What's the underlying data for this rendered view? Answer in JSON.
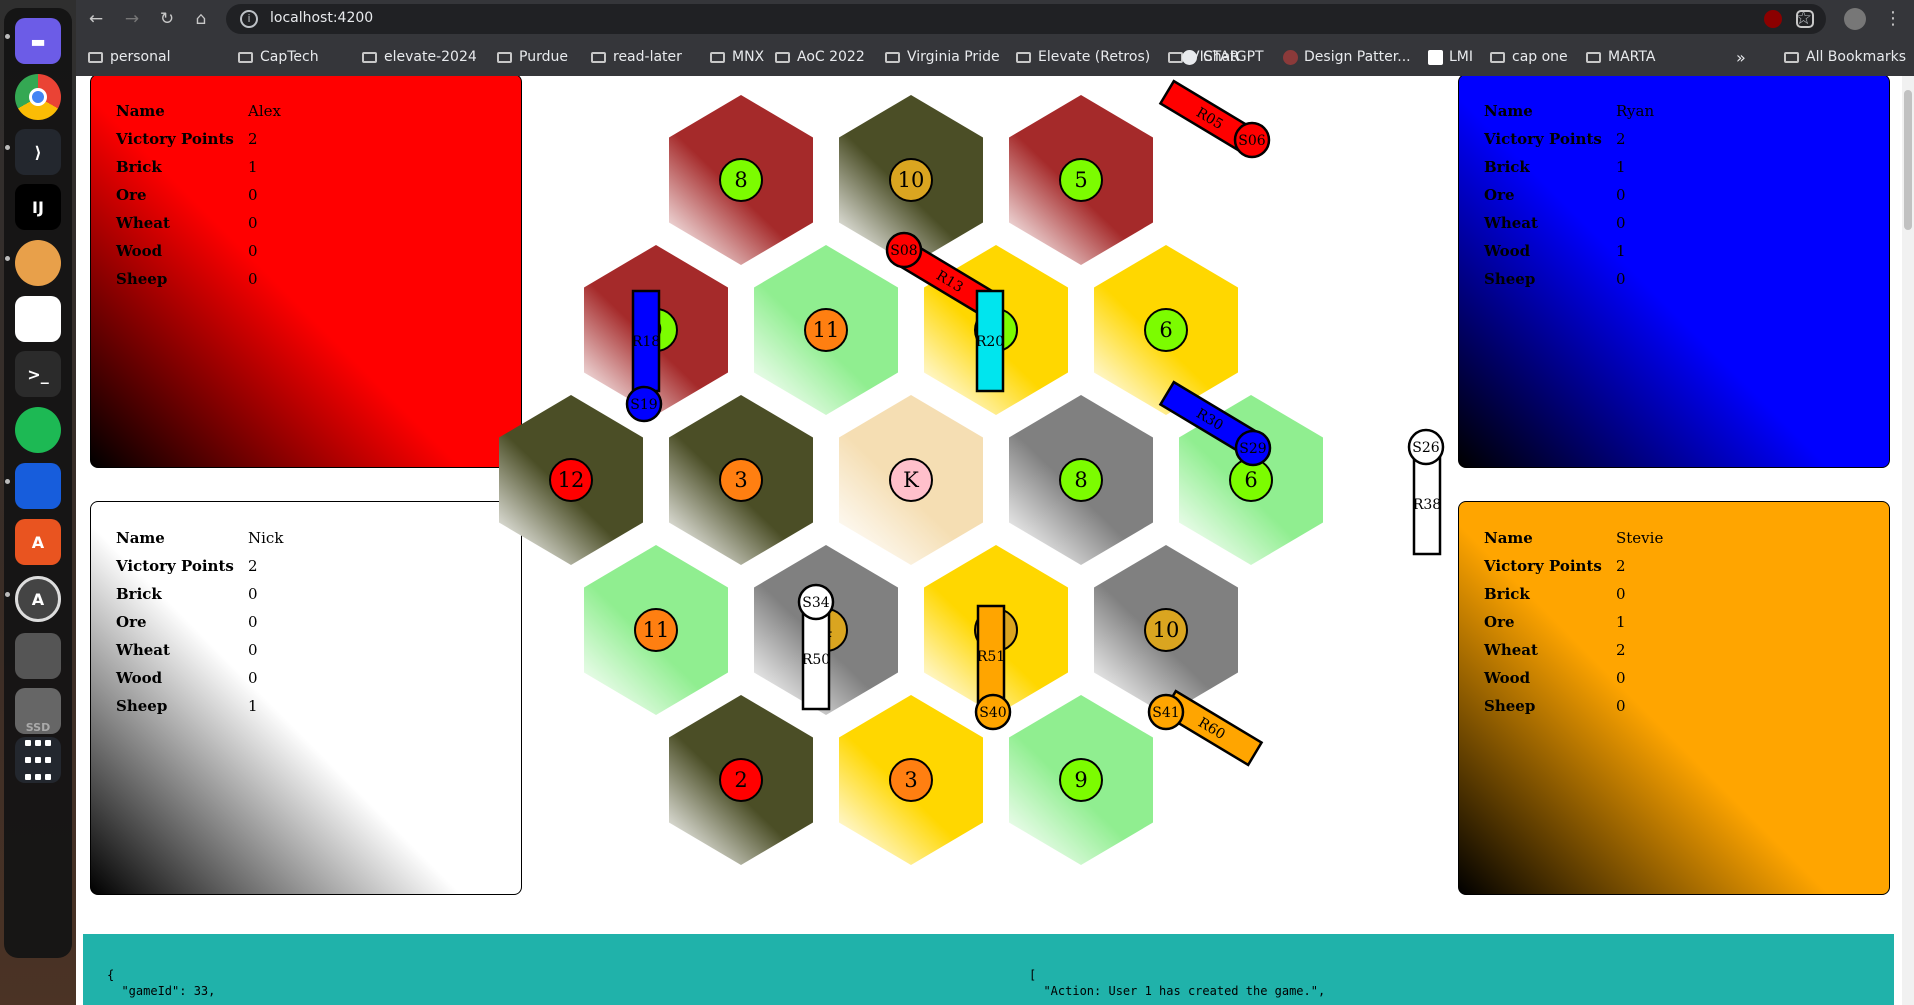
{
  "dock": {
    "items": [
      {
        "name": "files-icon",
        "color": "#6c5ce7",
        "glyph": "▬"
      },
      {
        "name": "chrome-icon",
        "color": "#ffffff",
        "glyph": ""
      },
      {
        "name": "vscode-icon",
        "color": "#23272e",
        "glyph": "⟩"
      },
      {
        "name": "intellij-icon",
        "color": "#000000",
        "glyph": "IJ"
      },
      {
        "name": "dog-icon",
        "color": "#23272e",
        "glyph": ""
      },
      {
        "name": "gimp-icon",
        "color": "#ffffff",
        "glyph": ""
      },
      {
        "name": "terminal-icon",
        "color": "#2b2b2b",
        "glyph": ">_"
      },
      {
        "name": "spotify-icon",
        "color": "#1db954",
        "glyph": ""
      },
      {
        "name": "bitwarden-icon",
        "color": "#175ddc",
        "glyph": ""
      },
      {
        "name": "app-center-icon",
        "color": "#e95420",
        "glyph": "A"
      },
      {
        "name": "software-updater-icon",
        "color": "#444444",
        "glyph": "A"
      },
      {
        "name": "usb-icon",
        "color": "#555555",
        "glyph": ""
      },
      {
        "name": "ssd-icon",
        "color": "#666666",
        "glyph": "SSD"
      },
      {
        "name": "app-grid-icon",
        "color": "#23272e",
        "glyph": ""
      }
    ]
  },
  "browser": {
    "url": "localhost:4200",
    "bookmarks": [
      {
        "label": "personal",
        "type": "folder"
      },
      {
        "label": "CapTech",
        "type": "folder"
      },
      {
        "label": "elevate-2024",
        "type": "folder"
      },
      {
        "label": "Purdue",
        "type": "folder"
      },
      {
        "label": "read-later",
        "type": "folder"
      },
      {
        "label": "MNX",
        "type": "folder"
      },
      {
        "label": "AoC 2022",
        "type": "folder"
      },
      {
        "label": "Virginia Pride",
        "type": "folder"
      },
      {
        "label": "Elevate (Retros)",
        "type": "folder"
      },
      {
        "label": "VISTAR",
        "type": "folder"
      },
      {
        "label": "ChatGPT",
        "type": "site"
      },
      {
        "label": "Design Patter...",
        "type": "site"
      },
      {
        "label": "LMI",
        "type": "site"
      },
      {
        "label": "cap one",
        "type": "folder"
      },
      {
        "label": "MARTA",
        "type": "folder"
      }
    ],
    "overflow": "»",
    "all_bookmarks": "All Bookmarks"
  },
  "stat_labels": [
    "Name",
    "Victory Points",
    "Brick",
    "Ore",
    "Wheat",
    "Wood",
    "Sheep"
  ],
  "players": [
    {
      "id": "alex",
      "name": "Alex",
      "victory_points": "2",
      "brick": "1",
      "ore": "0",
      "wheat": "0",
      "wood": "0",
      "sheep": "0",
      "color": "#ff0000"
    },
    {
      "id": "ryan",
      "name": "Ryan",
      "victory_points": "2",
      "brick": "1",
      "ore": "0",
      "wheat": "0",
      "wood": "1",
      "sheep": "0",
      "color": "#0000ff"
    },
    {
      "id": "nick",
      "name": "Nick",
      "victory_points": "2",
      "brick": "0",
      "ore": "0",
      "wheat": "0",
      "wood": "0",
      "sheep": "1",
      "color": "#ffffff"
    },
    {
      "id": "stevie",
      "name": "Stevie",
      "victory_points": "2",
      "brick": "0",
      "ore": "1",
      "wheat": "2",
      "wood": "0",
      "sheep": "0",
      "color": "#ffa500"
    }
  ],
  "resource_colors": {
    "brick": "#a52a2a",
    "wood": "#4b4e26",
    "wheat": "#ffd700",
    "sheep": "#90ee90",
    "ore": "#808080",
    "desert": "#f5deb3"
  },
  "board": {
    "rows": [
      [
        {
          "r": "brick",
          "n": "8"
        },
        {
          "r": "wood",
          "n": "10"
        },
        {
          "r": "brick",
          "n": "5"
        }
      ],
      [
        {
          "r": "brick",
          "n": "9"
        },
        {
          "r": "sheep",
          "n": "11"
        },
        {
          "r": "wheat",
          "n": "5"
        },
        {
          "r": "wheat",
          "n": "6"
        }
      ],
      [
        {
          "r": "wood",
          "n": "12"
        },
        {
          "r": "wood",
          "n": "3"
        },
        {
          "r": "desert",
          "n": "K"
        },
        {
          "r": "ore",
          "n": "8"
        },
        {
          "r": "sheep",
          "n": "6"
        }
      ],
      [
        {
          "r": "sheep",
          "n": "11"
        },
        {
          "r": "ore",
          "n": "4"
        },
        {
          "r": "wheat",
          "n": "4"
        },
        {
          "r": "ore",
          "n": "10"
        }
      ],
      [
        {
          "r": "wood",
          "n": "2"
        },
        {
          "r": "wheat",
          "n": "3"
        },
        {
          "r": "sheep",
          "n": "9"
        }
      ]
    ],
    "roads": [
      {
        "label": "R05",
        "color": "#ff0000"
      },
      {
        "label": "R13",
        "color": "#ff0000"
      },
      {
        "label": "R18",
        "color": "#0000ff"
      },
      {
        "label": "R20",
        "color": "#00e5ee"
      },
      {
        "label": "R30",
        "color": "#0000ff"
      },
      {
        "label": "R38",
        "color": "#ffffff"
      },
      {
        "label": "R50",
        "color": "#ffffff"
      },
      {
        "label": "R51",
        "color": "#ffa500"
      },
      {
        "label": "R60",
        "color": "#ffa500"
      }
    ],
    "settlements": [
      {
        "label": "S06",
        "color": "#ff0000"
      },
      {
        "label": "S08",
        "color": "#ff0000"
      },
      {
        "label": "S19",
        "color": "#0000ff"
      },
      {
        "label": "S29",
        "color": "#0000ff"
      },
      {
        "label": "S26",
        "color": "#ffffff"
      },
      {
        "label": "S34",
        "color": "#ffffff"
      },
      {
        "label": "S40",
        "color": "#ffa500"
      },
      {
        "label": "S41",
        "color": "#ffa500"
      }
    ]
  },
  "json_area": {
    "left_line1": "{",
    "left_line2": "  \"gameId\": 33,",
    "right_line1": "[",
    "right_line2": "  \"Action: User 1 has created the game.\","
  }
}
